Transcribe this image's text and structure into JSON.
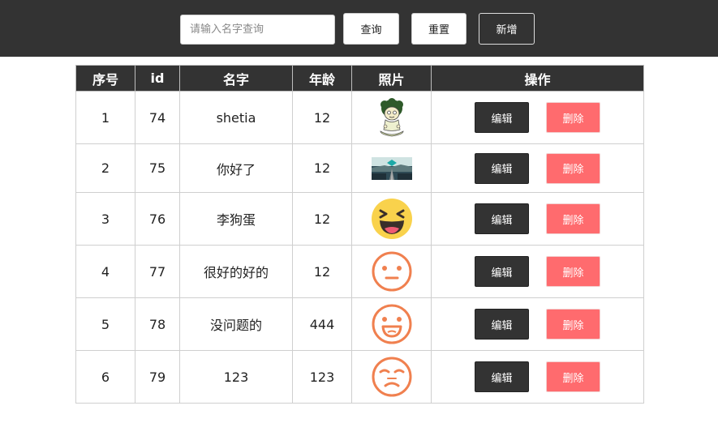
{
  "toolbar": {
    "search_placeholder": "请输入名字查询",
    "query_label": "查询",
    "reset_label": "重置",
    "add_label": "新增"
  },
  "table": {
    "headers": [
      "序号",
      "id",
      "名字",
      "年龄",
      "照片",
      "操作"
    ],
    "rows": [
      {
        "index": "1",
        "id": "74",
        "name": "shetia",
        "age": "12",
        "photo": "cartoon-boy-meditating",
        "edit": "编辑",
        "delete": "删除"
      },
      {
        "index": "2",
        "id": "75",
        "name": "你好了",
        "age": "12",
        "photo": "landscape-road",
        "edit": "编辑",
        "delete": "删除"
      },
      {
        "index": "3",
        "id": "76",
        "name": "李狗蛋",
        "age": "12",
        "photo": "laughing-emoji",
        "edit": "编辑",
        "delete": "删除"
      },
      {
        "index": "4",
        "id": "77",
        "name": "很好的好的",
        "age": "12",
        "photo": "neutral-face",
        "edit": "编辑",
        "delete": "删除"
      },
      {
        "index": "5",
        "id": "78",
        "name": "没问题的",
        "age": "444",
        "photo": "smiling-face",
        "edit": "编辑",
        "delete": "删除"
      },
      {
        "index": "6",
        "id": "79",
        "name": "123",
        "age": "123",
        "photo": "frowning-face",
        "edit": "编辑",
        "delete": "删除"
      }
    ]
  },
  "colors": {
    "header_bg": "#333333",
    "delete_button": "#ff6b6e",
    "edit_button": "#333333",
    "face_outline": "#f0804f",
    "emoji_yellow": "#f9d24c"
  }
}
